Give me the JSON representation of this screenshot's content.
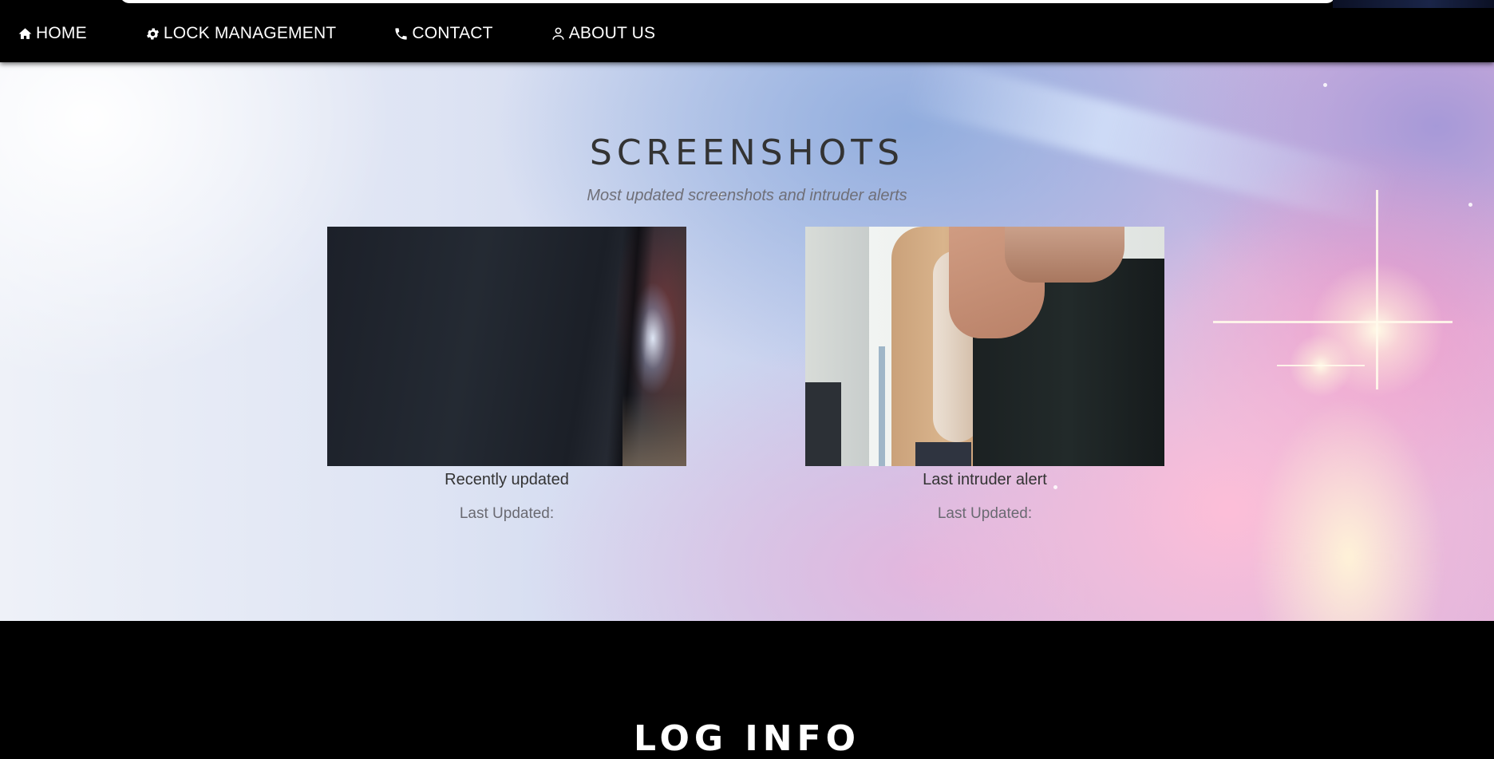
{
  "nav": {
    "items": [
      {
        "label": "HOME",
        "icon": "home-icon"
      },
      {
        "label": "LOCK MANAGEMENT",
        "icon": "gear-icon"
      },
      {
        "label": "CONTACT",
        "icon": "phone-icon"
      },
      {
        "label": "ABOUT US",
        "icon": "user-icon"
      }
    ]
  },
  "screenshots": {
    "title": "SCREENSHOTS",
    "subtitle": "Most updated screenshots and intruder alerts",
    "cards": [
      {
        "caption": "Recently updated",
        "updated_label": "Last Updated:"
      },
      {
        "caption": "Last intruder alert",
        "updated_label": "Last Updated:"
      }
    ]
  },
  "next_section": {
    "title_partial": "LOG INFO"
  },
  "colors": {
    "nav_bg": "#000000",
    "title": "#333333",
    "subtitle": "#6f6f78"
  }
}
